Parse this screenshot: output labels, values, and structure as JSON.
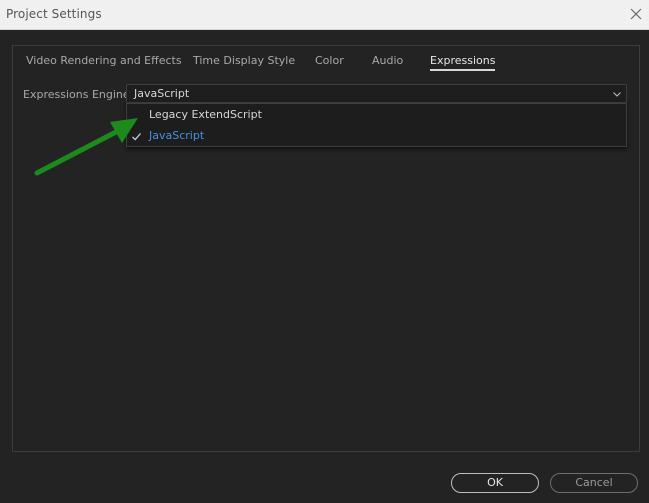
{
  "window": {
    "title": "Project Settings"
  },
  "tabs": [
    {
      "label": "Video Rendering and Effects",
      "active": false
    },
    {
      "label": "Time Display Style",
      "active": false
    },
    {
      "label": "Color",
      "active": false
    },
    {
      "label": "Audio",
      "active": false
    },
    {
      "label": "Expressions",
      "active": true
    }
  ],
  "expressions": {
    "engine_label": "Expressions Engine:",
    "engine_value": "JavaScript",
    "options": [
      {
        "label": "Legacy ExtendScript",
        "selected": false
      },
      {
        "label": "JavaScript",
        "selected": true
      }
    ]
  },
  "buttons": {
    "ok": "OK",
    "cancel": "Cancel"
  },
  "icons": {
    "close": "close-icon",
    "chevron": "chevron-down-icon",
    "check": "checkmark-icon",
    "annotation": "green-arrow-annotation"
  },
  "colors": {
    "background": "#232323",
    "selected_option": "#4a8fe0",
    "annotation_arrow": "#1d8a1d"
  }
}
